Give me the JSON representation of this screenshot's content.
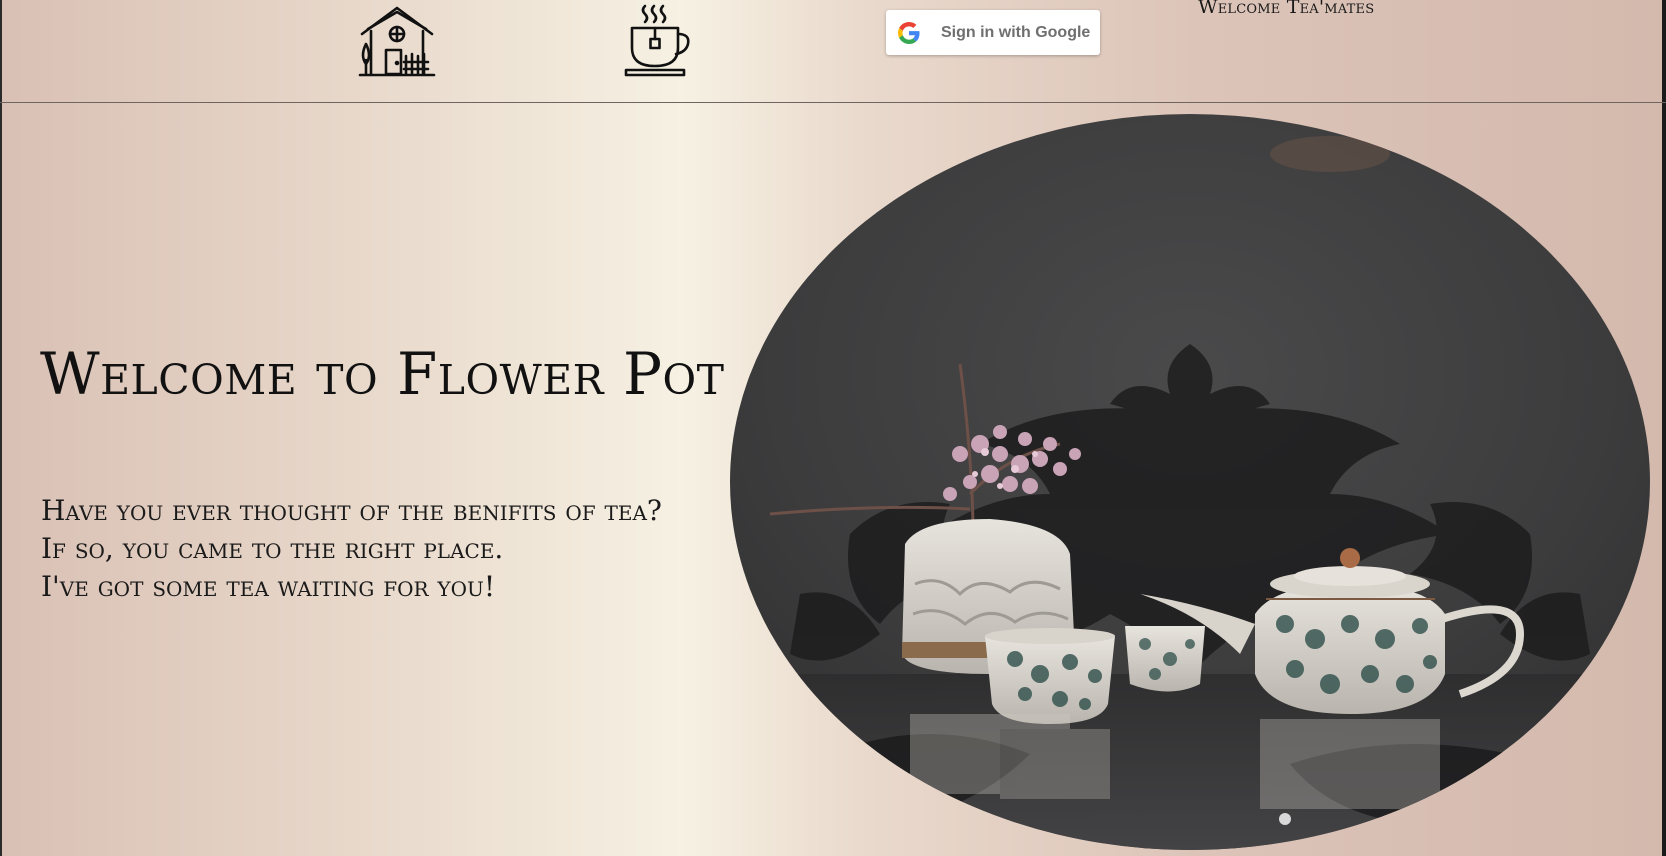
{
  "header": {
    "home_icon": "house-icon",
    "tea_icon": "tea-cup-icon",
    "google_button": {
      "label": "Sign in with Google",
      "icon": "google-g-icon"
    },
    "greeting": "Welcome Tea'mates"
  },
  "hero": {
    "title": "Welcome to Flower Pot",
    "lines": [
      "Have you ever thought of the benifits of tea?",
      "If so, you came to the right place.",
      "I've got some tea waiting for you!"
    ],
    "image": "teapot-and-flower-vase-photo"
  },
  "colors": {
    "text": "#111111",
    "header_rule": "#6e6560",
    "bg_rose": "#d9c0b4",
    "bg_cream": "#f6f1e3",
    "photo_dark": "#3d3d3d"
  }
}
